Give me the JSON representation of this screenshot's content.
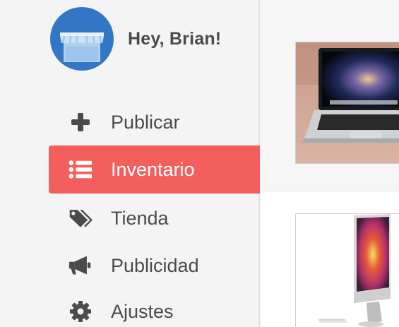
{
  "profile": {
    "greeting": "Hey, Brian!",
    "avatar_icon": "storefront-icon",
    "avatar_color": "#3476c6"
  },
  "nav": {
    "active_color": "#f25f5c",
    "items": [
      {
        "label": "Publicar",
        "icon": "plus-icon",
        "active": false
      },
      {
        "label": "Inventario",
        "icon": "list-icon",
        "active": true
      },
      {
        "label": "Tienda",
        "icon": "tags-icon",
        "active": false
      },
      {
        "label": "Publicidad",
        "icon": "megaphone-icon",
        "active": false
      },
      {
        "label": "Ajustes",
        "icon": "gear-icon",
        "active": false
      }
    ]
  },
  "products": [
    {
      "image": "laptop-image"
    },
    {
      "image": "desktop-computer-image"
    }
  ]
}
